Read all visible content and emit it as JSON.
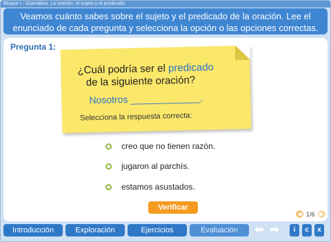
{
  "breadcrumb": "Bloque I -   Gramática. La oración: el sujeto y el predicado",
  "instruction": "Veamos cuánto sabes sobre el sujeto y el predicado de la oración. Lee el enunciado de cada pregunta y selecciona la opción o las opciones correctas.",
  "question": {
    "label": "Pregunta 1:",
    "prompt_before": "¿Cuál podría ser el ",
    "prompt_highlight": "predicado",
    "prompt_after": "de la siguiente oración?",
    "sentence": "Nosotros _____________.",
    "hint": "Selecciona la respuesta correcta:"
  },
  "options": [
    {
      "label": "creo que no tienen razón."
    },
    {
      "label": "jugaron al parchís."
    },
    {
      "label": "estamos asustados."
    }
  ],
  "verify_label": "Verificar",
  "pager": {
    "text": "1/6"
  },
  "nav": {
    "intro": "Introducción",
    "explore": "Exploración",
    "exercises": "Ejercicios",
    "evaluation": "Evaluación"
  },
  "tools": {
    "info": "i",
    "contents": "c",
    "close": "x"
  },
  "icons": [
    "left-arrow-icon",
    "right-arrow-icon",
    "prev-icon",
    "next-icon"
  ],
  "colors": {
    "accent": "#3f86d2",
    "note": "#fbe76a",
    "button": "#f49b20",
    "radio": "#8fb43a"
  }
}
